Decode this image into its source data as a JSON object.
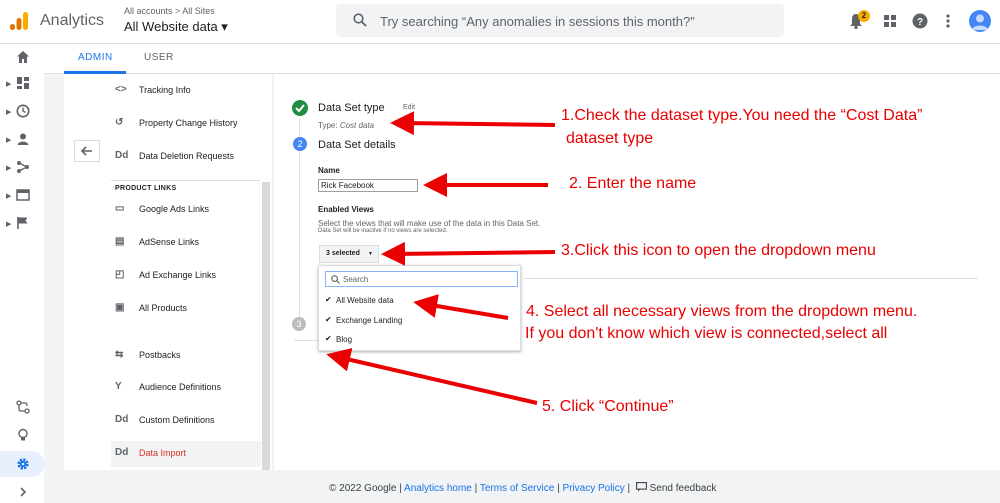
{
  "header": {
    "app_title": "Analytics",
    "breadcrumb": "All accounts > All Sites",
    "property": "All Website data ▾",
    "search_placeholder": "Try searching “Any anomalies in sessions this month?”",
    "notification_count": "2"
  },
  "tabs": {
    "admin": "ADMIN",
    "user": "USER"
  },
  "nav": {
    "items_top": [
      {
        "icon": "<>",
        "label": "Tracking Info"
      },
      {
        "icon": "↺",
        "label": "Property Change History"
      },
      {
        "icon": "Dd",
        "label": "Data Deletion Requests"
      }
    ],
    "section_title": "PRODUCT LINKS",
    "items_links": [
      {
        "icon": "▭",
        "label": "Google Ads Links"
      },
      {
        "icon": "▤",
        "label": "AdSense Links"
      },
      {
        "icon": "◰",
        "label": "Ad Exchange Links"
      },
      {
        "icon": "▣",
        "label": "All Products"
      }
    ],
    "items_bottom": [
      {
        "icon": "⇆",
        "label": "Postbacks"
      },
      {
        "icon": "Y",
        "label": "Audience Definitions"
      },
      {
        "icon": "Dd",
        "label": "Custom Definitions"
      },
      {
        "icon": "Dd",
        "label": "Data Import"
      }
    ]
  },
  "main": {
    "step1_title": "Data Set type",
    "step1_edit": "Edit",
    "step1_type_label": "Type:",
    "step1_type_value": "Cost data",
    "step2_number": "2",
    "step2_title": "Data Set details",
    "name_label": "Name",
    "name_value": "Rick Facebook",
    "views_label": "Enabled Views",
    "views_help": "Select the views that will make use of the data in this Data Set.",
    "views_help2": "Data Set will be inactive if no views are selected.",
    "select_button": "3 selected",
    "step3_number": "3",
    "dropdown": {
      "search_placeholder": "Search",
      "options": [
        "All Website data",
        "Exchange Landing",
        "Blog"
      ]
    }
  },
  "annotations": {
    "a1_line1": "1.Check the dataset type.You need the “Cost Data”",
    "a1_line2": "dataset type",
    "a2": "2. Enter the name",
    "a3": "3.Click this icon to open the dropdown menu",
    "a4_line1": "4. Select all necessary views from the dropdown menu.",
    "a4_line2": "If you don't know which view is connected,select all",
    "a5": "5. Click “Continue”"
  },
  "footer": {
    "copyright": "© 2022 Google |",
    "link1": "Analytics home",
    "link2": "Terms of Service",
    "link3": "Privacy Policy",
    "feedback": "Send feedback"
  },
  "colors": {
    "accent": "#1a73e8",
    "annotation": "#ea0000",
    "success": "#1e8e3e",
    "active_nav_text": "#d93025"
  }
}
